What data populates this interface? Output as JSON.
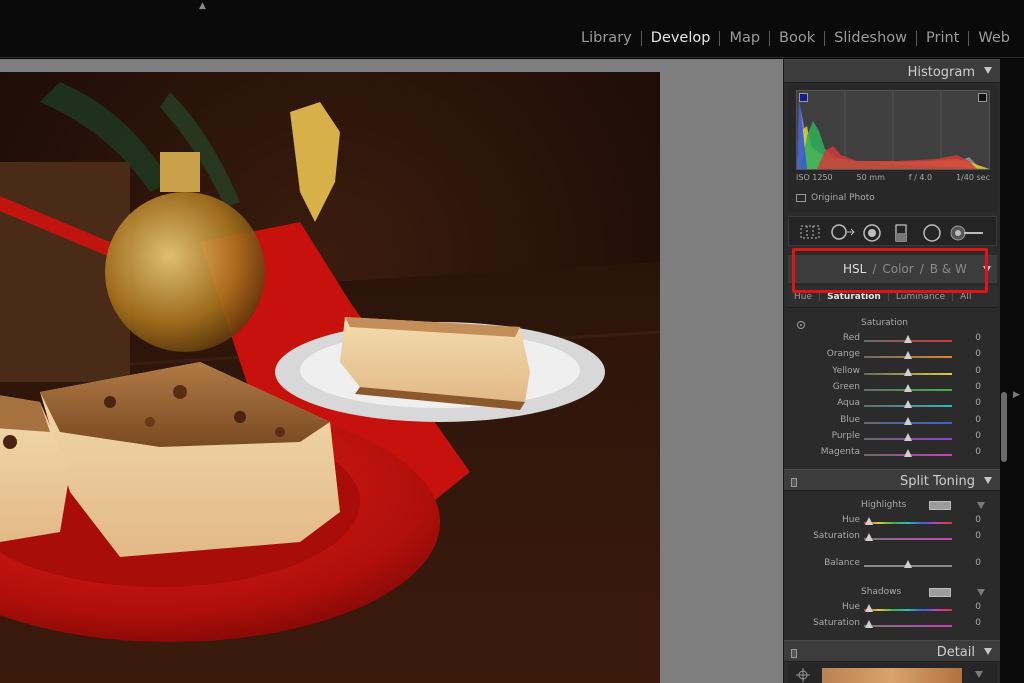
{
  "modules": [
    "Library",
    "Develop",
    "Map",
    "Book",
    "Slideshow",
    "Print",
    "Web"
  ],
  "active_module": "Develop",
  "histogram": {
    "title": "Histogram",
    "iso": "ISO 1250",
    "focal": "50 mm",
    "aperture": "f / 4.0",
    "shutter": "1/40 sec",
    "original_photo": "Original Photo"
  },
  "hsl": {
    "tab_hsl": "HSL",
    "tab_color": "Color",
    "tab_bw": "B & W",
    "sep": "/",
    "subtab_hue": "Hue",
    "subtab_saturation": "Saturation",
    "subtab_luminance": "Luminance",
    "subtab_all": "All",
    "section_title": "Saturation",
    "rows": [
      {
        "label": "Red",
        "value": "0",
        "color": "#d23a3a"
      },
      {
        "label": "Orange",
        "value": "0",
        "color": "#d98a2b"
      },
      {
        "label": "Yellow",
        "value": "0",
        "color": "#d8cf3a"
      },
      {
        "label": "Green",
        "value": "0",
        "color": "#43b04a"
      },
      {
        "label": "Aqua",
        "value": "0",
        "color": "#2fb8b6"
      },
      {
        "label": "Blue",
        "value": "0",
        "color": "#3a62d4"
      },
      {
        "label": "Purple",
        "value": "0",
        "color": "#8a45c9"
      },
      {
        "label": "Magenta",
        "value": "0",
        "color": "#c83fb5"
      }
    ]
  },
  "split_toning": {
    "title": "Split Toning",
    "highlights": "Highlights",
    "hue": "Hue",
    "saturation": "Saturation",
    "balance": "Balance",
    "shadows": "Shadows",
    "hl_hue_value": "0",
    "hl_sat_value": "0",
    "balance_value": "0",
    "sh_hue_value": "0",
    "sh_sat_value": "0"
  },
  "detail": {
    "title": "Detail"
  },
  "colors": {
    "highlight_box": "#e01414",
    "panel_bg": "#2b2b2b",
    "canvas_bg": "#7e7e7e"
  }
}
